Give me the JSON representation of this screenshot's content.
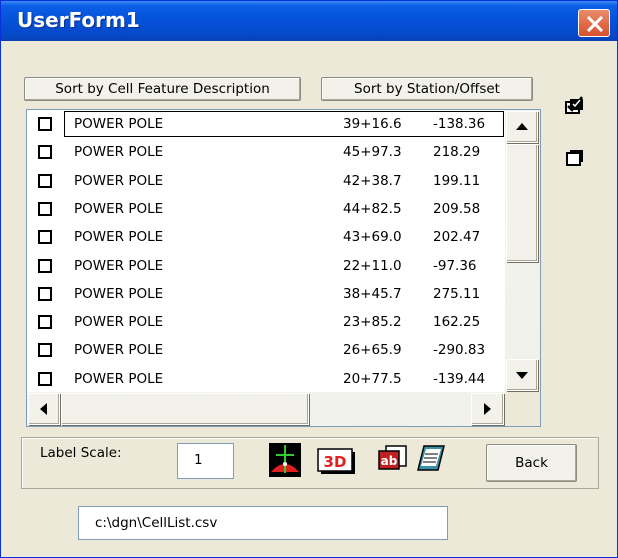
{
  "window": {
    "title": "UserForm1"
  },
  "buttons": {
    "sort_description": "Sort by Cell Feature Description",
    "sort_station": "Sort by Station/Offset",
    "back": "Back"
  },
  "list": {
    "rows": [
      {
        "name": "POWER POLE",
        "station": "39+16.6",
        "offset": "-138.36",
        "checked": false
      },
      {
        "name": "POWER POLE",
        "station": "45+97.3",
        "offset": "218.29",
        "checked": false
      },
      {
        "name": "POWER POLE",
        "station": "42+38.7",
        "offset": "199.11",
        "checked": false
      },
      {
        "name": "POWER POLE",
        "station": "44+82.5",
        "offset": "209.58",
        "checked": false
      },
      {
        "name": "POWER POLE",
        "station": "43+69.0",
        "offset": "202.47",
        "checked": false
      },
      {
        "name": "POWER POLE",
        "station": "22+11.0",
        "offset": "-97.36",
        "checked": false
      },
      {
        "name": "POWER POLE",
        "station": "38+45.7",
        "offset": "275.11",
        "checked": false
      },
      {
        "name": "POWER POLE",
        "station": "23+85.2",
        "offset": "162.25",
        "checked": false
      },
      {
        "name": "POWER POLE",
        "station": "26+65.9",
        "offset": "-290.83",
        "checked": false
      },
      {
        "name": "POWER POLE",
        "station": "20+77.5",
        "offset": "-139.44",
        "checked": false
      }
    ]
  },
  "label_scale": {
    "label": "Label Scale:",
    "value": "1"
  },
  "file_path": {
    "value": "c:\\dgn\\CellList.csv"
  },
  "colors": {
    "titlebar": "#0551D9",
    "close_button": "#D8502C",
    "dialog_bg": "#ECE9D8"
  },
  "icons": [
    "check-all-icon",
    "uncheck-all-icon",
    "place-cell-icon",
    "3d-view-icon",
    "text-label-icon",
    "notebook-icon"
  ]
}
